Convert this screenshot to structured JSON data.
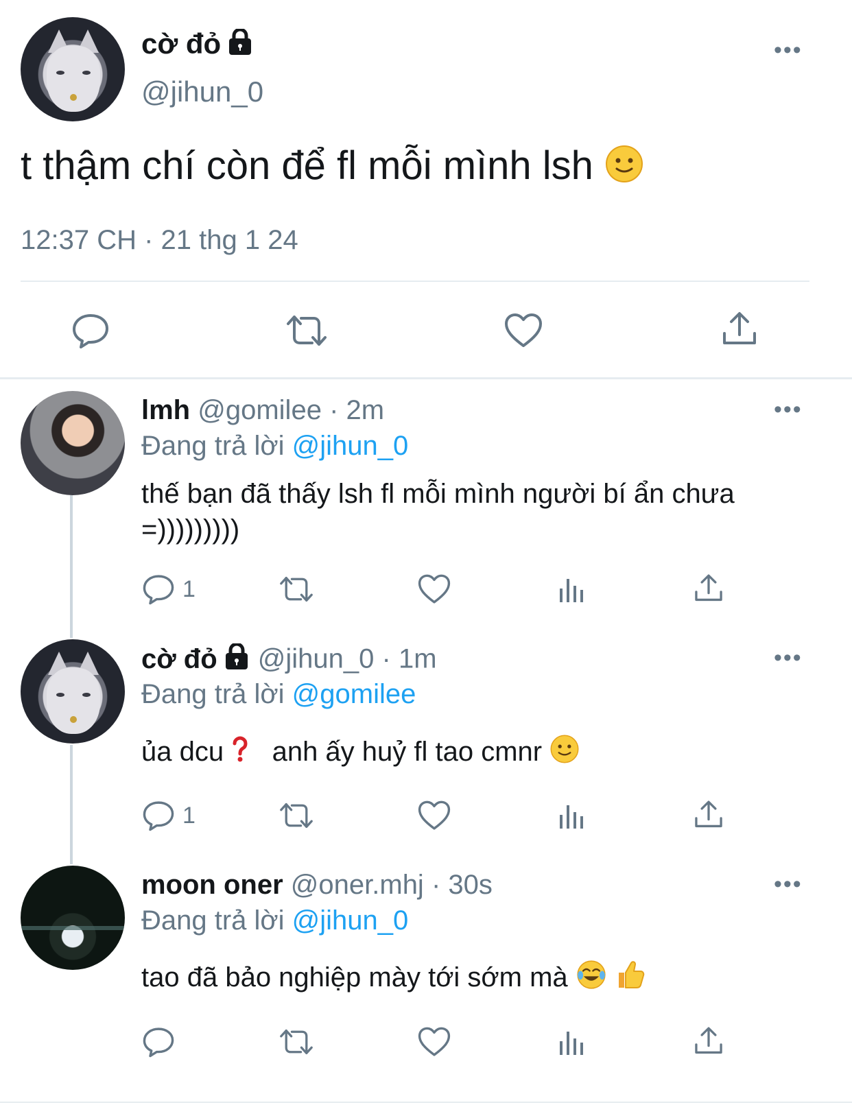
{
  "main_tweet": {
    "display_name": "cờ đỏ",
    "handle": "@jihun_0",
    "text": "t thậm chí còn để fl mỗi mình lsh",
    "timestamp": "12:37 CH · 21 thg 1 24",
    "more_label": "•••",
    "icons": [
      "reply-icon",
      "retweet-icon",
      "like-icon",
      "share-icon"
    ]
  },
  "replies": [
    {
      "display_name": "lmh",
      "handle": "@gomilee",
      "time": "· 2m",
      "replying_label": "Đang trả lời",
      "replying_to": "@jihun_0",
      "text": "thế bạn đã thấy lsh fl mỗi mình người bí ẩn chưa =)))))))))",
      "reply_count": "1"
    },
    {
      "display_name": "cờ đỏ",
      "handle": "@jihun_0",
      "time": "· 1m",
      "replying_label": "Đang trả lời",
      "replying_to": "@gomilee",
      "text_a": "ủa dcu",
      "text_b": "anh ấy huỷ fl tao cmnr",
      "reply_count": "1"
    },
    {
      "display_name": "moon oner",
      "handle": "@oner.mhj",
      "time": "· 30s",
      "replying_label": "Đang trả lời",
      "replying_to": "@jihun_0",
      "text": "tao đã bảo nghiệp mày tới sớm mà",
      "reply_count": ""
    }
  ],
  "colors": {
    "accent": "#1da1f2",
    "secondary": "#657786",
    "divider": "#e6ecf0"
  }
}
